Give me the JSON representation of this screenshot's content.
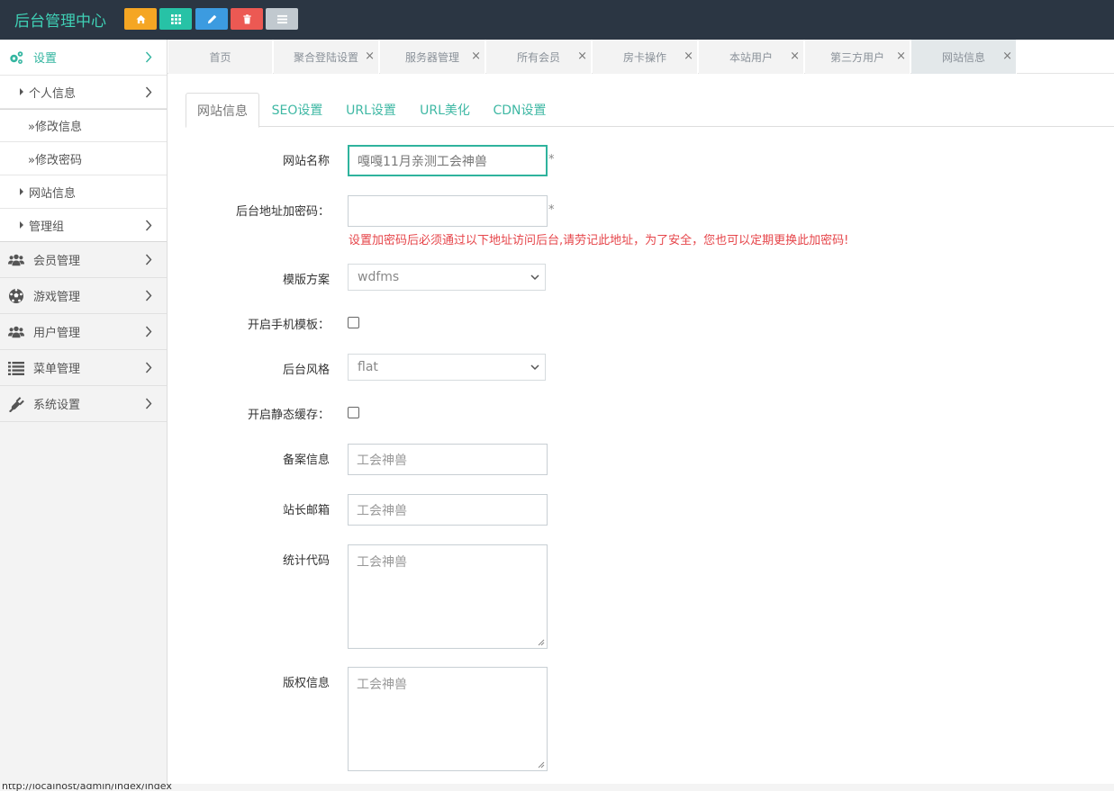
{
  "app": {
    "title": "后台管理中心"
  },
  "header": {
    "buttons": [
      {
        "name": "home-button",
        "icon": "home-icon",
        "color": "#f5a623"
      },
      {
        "name": "grid-button",
        "icon": "grid-icon",
        "color": "#27c2a6"
      },
      {
        "name": "edit-button",
        "icon": "pencil-icon",
        "color": "#3c9be0"
      },
      {
        "name": "delete-button",
        "icon": "trash-icon",
        "color": "#ec5953"
      },
      {
        "name": "list-button",
        "icon": "list-icon",
        "color": "#c1c9cf"
      }
    ]
  },
  "sidebar": {
    "settings": {
      "label": "设置",
      "icon": "gears-icon",
      "active": true
    },
    "settings_children": [
      {
        "label": "个人信息",
        "has_chevron": true
      },
      {
        "label": "»修改信息"
      },
      {
        "label": "»修改密码"
      },
      {
        "label": "网站信息"
      },
      {
        "label": "管理组",
        "has_chevron": true
      }
    ],
    "groups": [
      {
        "label": "会员管理",
        "icon": "users-icon"
      },
      {
        "label": "游戏管理",
        "icon": "soccer-ball-icon"
      },
      {
        "label": "用户管理",
        "icon": "users-icon"
      },
      {
        "label": "菜单管理",
        "icon": "list-icon"
      },
      {
        "label": "系统设置",
        "icon": "plug-icon"
      }
    ]
  },
  "page_tabs": [
    {
      "label": "首页",
      "closable": false
    },
    {
      "label": "聚合登陆设置",
      "closable": true
    },
    {
      "label": "服务器管理",
      "closable": true
    },
    {
      "label": "所有会员",
      "closable": true
    },
    {
      "label": "房卡操作",
      "closable": true
    },
    {
      "label": "本站用户",
      "closable": true
    },
    {
      "label": "第三方用户",
      "closable": true
    },
    {
      "label": "网站信息",
      "closable": true,
      "active": true
    }
  ],
  "close_glyph": "×",
  "content_tabs": [
    {
      "label": "网站信息",
      "active": true
    },
    {
      "label": "SEO设置"
    },
    {
      "label": "URL设置"
    },
    {
      "label": "URL美化"
    },
    {
      "label": "CDN设置"
    }
  ],
  "form": {
    "site_name": {
      "label": "网站名称",
      "value": "嘎嘎11月亲测工会神兽",
      "required_mark": "*"
    },
    "admin_secret": {
      "label": "后台地址加密码：",
      "value": "",
      "required_mark": "*",
      "warning": "设置加密码后必须通过以下地址访问后台,请劳记此地址，为了安全，您也可以定期更换此加密码!"
    },
    "template": {
      "label": "模版方案",
      "selected": "wdfms"
    },
    "mobile_template": {
      "label": "开启手机模板：",
      "checked": false
    },
    "admin_style": {
      "label": "后台风格",
      "selected": "flat"
    },
    "static_cache": {
      "label": "开启静态缓存：",
      "checked": false
    },
    "icp": {
      "label": "备案信息",
      "placeholder": "工会神兽"
    },
    "email": {
      "label": "站长邮箱",
      "placeholder": "工会神兽"
    },
    "stats_code": {
      "label": "统计代码",
      "placeholder": "工会神兽"
    },
    "copyright": {
      "label": "版权信息",
      "placeholder": "工会神兽"
    }
  },
  "status_bar": {
    "url": "http://localhost/admin/index/index"
  },
  "colors": {
    "topbar": "#2b3643",
    "brand": "#3fd0b5",
    "accent": "#33b5a0",
    "warning": "#e6454a"
  }
}
